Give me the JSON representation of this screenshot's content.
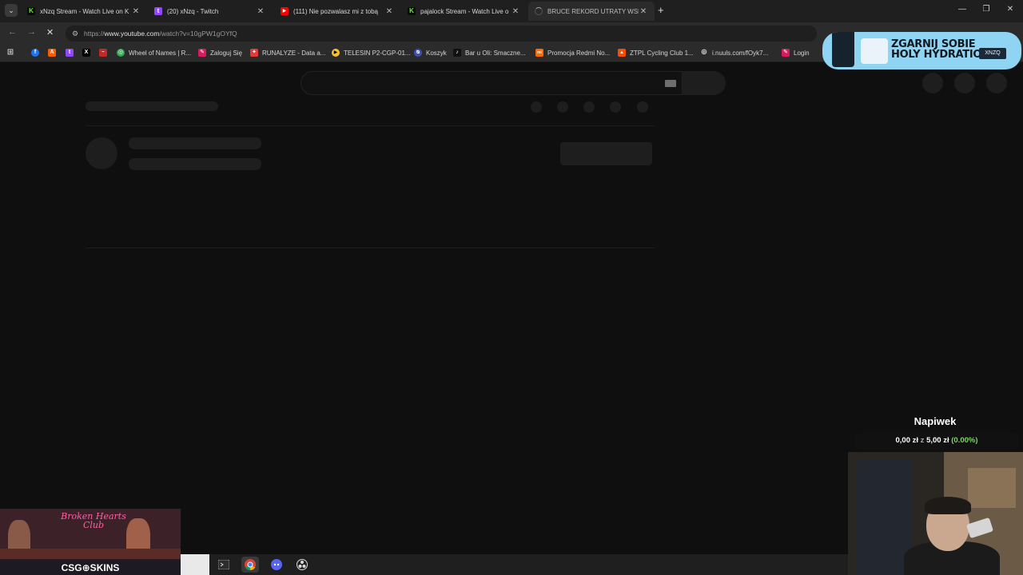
{
  "tabs": [
    {
      "title": "xNzq Stream - Watch Live on K",
      "favicon_color": "#53fc18",
      "favicon_char": "K",
      "active": false
    },
    {
      "title": "(20) xNzq - Twitch",
      "favicon_color": "#9146ff",
      "favicon_char": "t",
      "active": false
    },
    {
      "title": "(111) Nie pozwalasz mi z tobą",
      "favicon_color": "#ff0000",
      "favicon_char": "▶",
      "active": false
    },
    {
      "title": "pajalock Stream - Watch Live o",
      "favicon_color": "#53fc18",
      "favicon_char": "K",
      "active": false
    },
    {
      "title": "BRUCE REKORD UTRATY WSPÓ",
      "favicon_color": "#555555",
      "favicon_char": "",
      "active": true
    }
  ],
  "toolbar": {
    "url_scheme": "https://",
    "url_host": "www.youtube.com",
    "url_path": "/watch?v=10gPW1gOYfQ"
  },
  "bookmarks": [
    {
      "label": "",
      "icon": "apps-grid-icon",
      "color": "#cccccc",
      "char": "⊞"
    },
    {
      "label": "",
      "icon": "facebook-icon",
      "color": "#1877f2",
      "char": "f"
    },
    {
      "label": "",
      "icon": "allegro-icon",
      "color": "#ff5a00",
      "char": "A"
    },
    {
      "label": "",
      "icon": "twitch-icon",
      "color": "#9146ff",
      "char": "t"
    },
    {
      "label": "",
      "icon": "x-icon",
      "color": "#000000",
      "char": "X"
    },
    {
      "label": "",
      "icon": "pl-icon",
      "color": "#c62828",
      "char": "~"
    },
    {
      "label": "Wheel of Names | R...",
      "icon": "wheel-icon",
      "color": "#34a853",
      "char": "◎"
    },
    {
      "label": "Zaloguj Się",
      "icon": "bookmark-icon",
      "color": "#d81b60",
      "char": "✎"
    },
    {
      "label": "RUNALYZE - Data a...",
      "icon": "runalyze-icon",
      "color": "#e53935",
      "char": "✦"
    },
    {
      "label": "TELESIN P2-CGP-01...",
      "icon": "telesin-icon",
      "color": "#fbc02d",
      "char": "▶"
    },
    {
      "label": "Koszyk",
      "icon": "cart-icon",
      "color": "#3f51b5",
      "char": "ᴓ"
    },
    {
      "label": "Bar u Oli: Smaczne...",
      "icon": "tiktok-icon",
      "color": "#111111",
      "char": "♪"
    },
    {
      "label": "Promocja Redmi No...",
      "icon": "xiaomi-icon",
      "color": "#ff6900",
      "char": "mi"
    },
    {
      "label": "ZTPL Cycling Club 1...",
      "icon": "strava-icon",
      "color": "#fc4c02",
      "char": "▲"
    },
    {
      "label": "i.nuuls.com/fOyk7...",
      "icon": "globe-icon",
      "color": "#888888",
      "char": "⊕"
    },
    {
      "label": "Login",
      "icon": "login-icon",
      "color": "#d81b60",
      "char": "✎"
    }
  ],
  "promo": {
    "headline": "ZGARNIJ SOBIE HOLY HYDRATION",
    "code": "XNZQ"
  },
  "tip": {
    "title": "Napiwek",
    "current": "0,00 zł",
    "separator": "z",
    "goal": "5,00 zł",
    "percent": "(0.00%)",
    "progress_fraction": 0.0
  },
  "sponsor": {
    "neon": "Broken Hearts Club",
    "brand": "CSG⊕SKINS"
  },
  "taskbar": [
    {
      "icon": "terminal-icon",
      "active": false
    },
    {
      "icon": "chrome-icon",
      "active": true
    },
    {
      "icon": "discord-icon",
      "active": false
    },
    {
      "icon": "obs-icon",
      "active": false
    }
  ]
}
